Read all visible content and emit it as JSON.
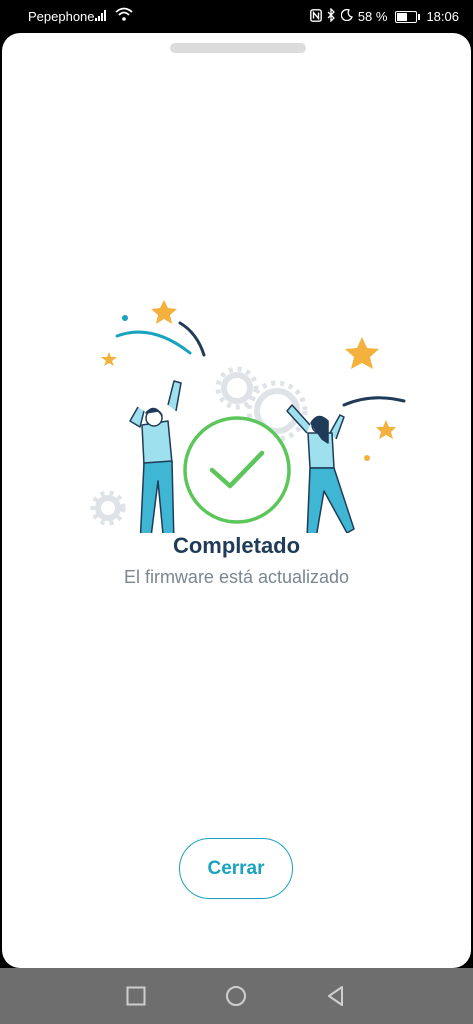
{
  "status_bar": {
    "carrier": "Pepephone",
    "battery_text": "58 %",
    "battery_level": 0.58,
    "time": "18:06",
    "icons": [
      "signal-icon",
      "wifi-icon",
      "nfc-icon",
      "bluetooth-icon",
      "moon-icon",
      "battery-icon"
    ]
  },
  "dialog": {
    "title": "Completado",
    "subtitle": "El firmware está actualizado",
    "close_label": "Cerrar"
  },
  "nav_bar": {
    "buttons": [
      "recents-button",
      "home-button",
      "back-button"
    ]
  },
  "colors": {
    "accent": "#1aa3bf",
    "success": "#5cc65a",
    "title": "#1f3b57",
    "star": "#f4b13d"
  }
}
